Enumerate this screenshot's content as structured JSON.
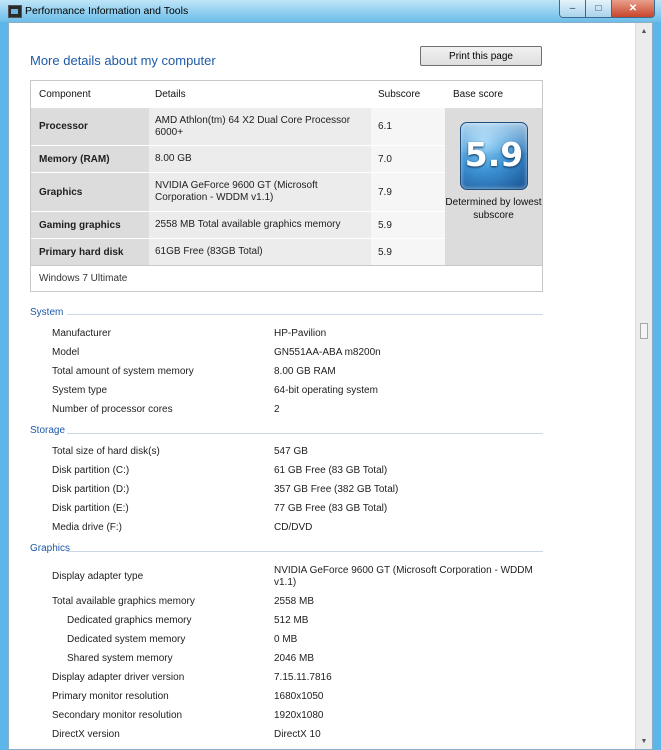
{
  "window": {
    "title": "Performance Information and Tools",
    "minimize_glyph": "–",
    "maximize_glyph": "□",
    "close_glyph": "✕"
  },
  "page": {
    "heading": "More details about my computer",
    "print_button": "Print this page"
  },
  "score_table": {
    "headers": {
      "component": "Component",
      "details": "Details",
      "subscore": "Subscore",
      "base": "Base score"
    },
    "rows": [
      {
        "component": "Processor",
        "details": "AMD Athlon(tm) 64 X2 Dual Core Processor 6000+",
        "subscore": "6.1"
      },
      {
        "component": "Memory (RAM)",
        "details": "8.00 GB",
        "subscore": "7.0"
      },
      {
        "component": "Graphics",
        "details": "NVIDIA GeForce 9600 GT (Microsoft Corporation - WDDM v1.1)",
        "subscore": "7.9"
      },
      {
        "component": "Gaming graphics",
        "details": "2558 MB Total available graphics memory",
        "subscore": "5.9"
      },
      {
        "component": "Primary hard disk",
        "details": "61GB Free (83GB Total)",
        "subscore": "5.9"
      }
    ],
    "base_score": "5.9",
    "base_note": "Determined by lowest subscore",
    "os": "Windows 7 Ultimate"
  },
  "system": {
    "title": "System",
    "rows": [
      {
        "label": "Manufacturer",
        "value": "HP-Pavilion"
      },
      {
        "label": "Model",
        "value": "GN551AA-ABA m8200n"
      },
      {
        "label": "Total amount of system memory",
        "value": "8.00 GB RAM"
      },
      {
        "label": "System type",
        "value": "64-bit operating system"
      },
      {
        "label": "Number of processor cores",
        "value": "2"
      }
    ]
  },
  "storage": {
    "title": "Storage",
    "rows": [
      {
        "label": "Total size of hard disk(s)",
        "value": "547 GB"
      },
      {
        "label": "Disk partition (C:)",
        "value": "61 GB Free (83 GB Total)"
      },
      {
        "label": "Disk partition (D:)",
        "value": "357 GB Free (382 GB Total)"
      },
      {
        "label": "Disk partition (E:)",
        "value": "77 GB Free (83 GB Total)"
      },
      {
        "label": "Media drive (F:)",
        "value": "CD/DVD"
      }
    ]
  },
  "graphics": {
    "title": "Graphics",
    "rows": [
      {
        "label": "Display adapter type",
        "value": "NVIDIA GeForce 9600 GT (Microsoft Corporation - WDDM v1.1)"
      },
      {
        "label": "Total available graphics memory",
        "value": "2558 MB"
      },
      {
        "label": "Dedicated graphics memory",
        "value": "512 MB"
      },
      {
        "label": "Dedicated system memory",
        "value": "0 MB"
      },
      {
        "label": "Shared system memory",
        "value": "2046 MB"
      },
      {
        "label": "Display adapter driver version",
        "value": "7.15.11.7816"
      },
      {
        "label": "Primary monitor resolution",
        "value": "1680x1050"
      },
      {
        "label": "Secondary monitor resolution",
        "value": "1920x1080"
      },
      {
        "label": "DirectX version",
        "value": "DirectX 10"
      }
    ]
  }
}
